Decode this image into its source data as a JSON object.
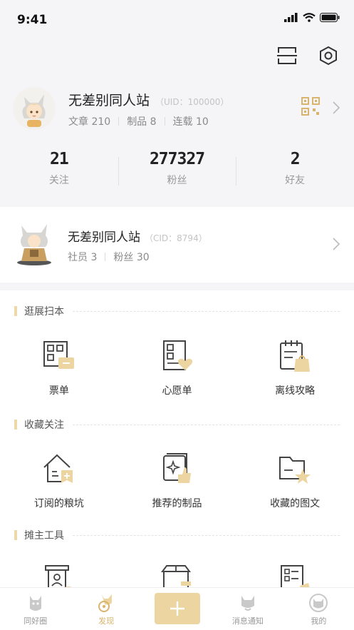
{
  "status": {
    "time": "9:41"
  },
  "topbar": {
    "icons": [
      "scan-icon",
      "settings-hex-icon"
    ]
  },
  "profile": {
    "name": "无差别同人站",
    "uid_text": "（UID：100000）",
    "stats": [
      {
        "label": "文章",
        "value": "210"
      },
      {
        "label": "制品",
        "value": "8"
      },
      {
        "label": "连载",
        "value": "10"
      }
    ]
  },
  "counts": [
    {
      "value": "21",
      "label": "关注"
    },
    {
      "value": "277327",
      "label": "粉丝"
    },
    {
      "value": "2",
      "label": "好友"
    }
  ],
  "club": {
    "name": "无差别同人站",
    "cid_text": "（CID：8794）",
    "stats": [
      {
        "label": "社员",
        "value": "3"
      },
      {
        "label": "粉丝",
        "value": "30"
      }
    ]
  },
  "sections": [
    {
      "title": "逛展扫本",
      "items": [
        {
          "label": "票单",
          "icon": "ticket-icon"
        },
        {
          "label": "心愿单",
          "icon": "wishlist-icon"
        },
        {
          "label": "离线攻略",
          "icon": "offline-guide-icon"
        }
      ]
    },
    {
      "title": "收藏关注",
      "items": [
        {
          "label": "订阅的粮坑",
          "icon": "subscribe-house-icon"
        },
        {
          "label": "推荐的制品",
          "icon": "recommend-icon"
        },
        {
          "label": "收藏的图文",
          "icon": "folder-star-icon"
        }
      ]
    },
    {
      "title": "摊主工具",
      "items": [
        {
          "label": "",
          "icon": "booth-person-icon"
        },
        {
          "label": "",
          "icon": "store-icon"
        },
        {
          "label": "",
          "icon": "checklist-icon"
        }
      ]
    }
  ],
  "tabs": [
    {
      "label": "同好圈",
      "icon": "circle-cat-icon",
      "active": false
    },
    {
      "label": "发现",
      "icon": "discover-icon",
      "active": true
    },
    {
      "label": "",
      "icon": "plus-icon",
      "active": false
    },
    {
      "label": "消息通知",
      "icon": "message-icon",
      "active": false
    },
    {
      "label": "我的",
      "icon": "profile-cat-icon",
      "active": false
    }
  ],
  "colors": {
    "accent": "#ecd5a0",
    "accent_dark": "#d9b46c",
    "bg": "#f5f5f7"
  }
}
